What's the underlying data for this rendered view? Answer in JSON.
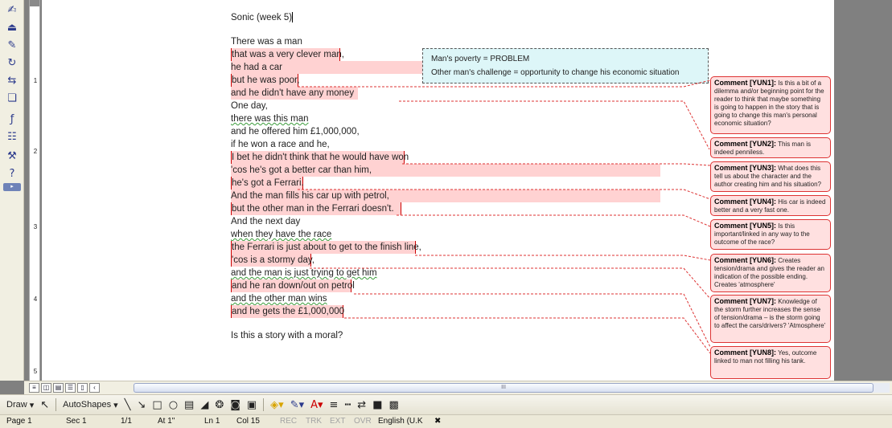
{
  "document": {
    "title_line": "Sonic (week 5)",
    "lines": [
      "There was a man",
      "that was a very clever man,",
      "he had a car",
      "but he was poor,",
      "and he didn't have any money",
      "One day,",
      "there was this man",
      "and he offered him £1,000,000,",
      "if he won a race and he,",
      "I bet he didn't think that he would have won",
      "'cos he's got a better car than him,",
      "he's got a Ferrari.",
      "And the man fills his car up with petrol,",
      "but the other man in the Ferrari doesn't.",
      "And the next day",
      "when they have the race",
      "the Ferrari is just about to get to the finish line,",
      "'cos is a stormy day,",
      "and the man is just trying to get him",
      "and he ran down/out on petrol",
      "and the other man wins",
      "and he gets the £1,000,000"
    ],
    "closing_question": "Is this a story with a moral?"
  },
  "callout": {
    "line1": "Man's poverty = PROBLEM",
    "line2": "Other man's challenge = opportunity to change his economic situation"
  },
  "comments": [
    {
      "label": "Comment [YUN1]:",
      "text": "Is this a bit of a dilemma and/or beginning point for the reader to think that maybe something is going to happen in the story that is going to change this man's personal economic situation?"
    },
    {
      "label": "Comment [YUN2]:",
      "text": "This man is indeed penniless."
    },
    {
      "label": "Comment [YUN3]:",
      "text": "What does this tell us about the character and the author creating him and his situation?"
    },
    {
      "label": "Comment [YUN4]:",
      "text": "His car is indeed better and a very fast one."
    },
    {
      "label": "Comment [YUN5]:",
      "text": "Is this important/linked in any way to the outcome of the race?"
    },
    {
      "label": "Comment [YUN6]:",
      "text": "Creates tension/drama and gives the reader an indication of the possible ending. Creates 'atmosphere'"
    },
    {
      "label": "Comment [YUN7]:",
      "text": "Knowledge of the storm further increases the sense of tension/drama – is the storm going to affect the cars/drivers? 'Atmosphere'"
    },
    {
      "label": "Comment [YUN8]:",
      "text": "Yes, outcome linked to man not filling his tank."
    }
  ],
  "ruler": {
    "marks": [
      "1",
      "2",
      "3",
      "4",
      "5"
    ]
  },
  "scrollbar": {
    "thumb_grip": "III"
  },
  "draw_toolbar": {
    "draw_label": "Draw",
    "autoshapes_label": "AutoShapes"
  },
  "status_bar": {
    "page": "Page 1",
    "section": "Sec 1",
    "page_of": "1/1",
    "at": "At 1\"",
    "ln": "Ln 1",
    "col": "Col 15",
    "rec": "REC",
    "trk": "TRK",
    "ext": "EXT",
    "ovr": "OVR",
    "language": "English (U.K"
  },
  "colors": {
    "highlight": "#ffd2d2",
    "comment_border": "#dd3333",
    "callout_bg": "#ddf6f8"
  }
}
